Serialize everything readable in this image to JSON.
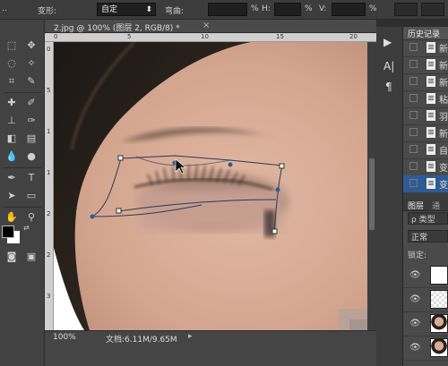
{
  "optionsBar": {
    "transformLabel": "变形:",
    "transformValue": "自定",
    "dropdownArrow": "⬍",
    "unitH": "%",
    "hLabel": "H:",
    "unitV": "%",
    "vLabel": "V:",
    "unit3": "%",
    "shearLabel": "弯曲:",
    "unitShear": "%"
  },
  "document": {
    "tabTitle": "2.jpg @ 100% (图层 2, RGB/8) *",
    "closeGlyph": "×",
    "zoom": "100%",
    "docInfo": "文档:6.11M/9.65M",
    "statusArrow": "▸"
  },
  "rulerTop": {
    "labels": [
      "0",
      "5",
      "10",
      "15",
      "20"
    ],
    "values": [
      0,
      5,
      10,
      15,
      20
    ]
  },
  "rulerLeft": {
    "labels": [
      "0",
      "5",
      "1",
      "1",
      "2",
      "2",
      "3"
    ],
    "values": [
      0,
      5,
      10,
      15,
      20,
      25,
      30
    ]
  },
  "narrowPanel": {
    "icons": [
      "▶",
      "A|",
      "¶"
    ]
  },
  "historyPanel": {
    "title": "历史记录",
    "menuGlyph": "≡",
    "rows": [
      {
        "label": "新",
        "selected": false
      },
      {
        "label": "新",
        "selected": false
      },
      {
        "label": "新",
        "selected": false
      },
      {
        "label": "粘",
        "selected": false
      },
      {
        "label": "羽",
        "selected": false
      },
      {
        "label": "新",
        "selected": false
      },
      {
        "label": "自",
        "selected": false
      },
      {
        "label": "变",
        "selected": false
      },
      {
        "label": "变",
        "selected": true
      }
    ]
  },
  "layersPanel": {
    "tabLayers": "图层",
    "tabChannels": "通",
    "searchPlaceholder": "ρ 类型",
    "blendMode": "正常",
    "lockLabel": "锁定:"
  },
  "colors": {
    "accent": "#2f5b94",
    "foreground": "#000000",
    "background": "#ffffff"
  }
}
